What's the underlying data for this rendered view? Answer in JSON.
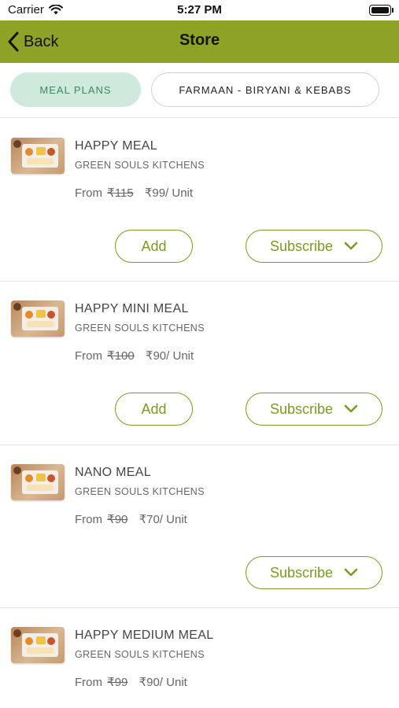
{
  "status_bar": {
    "carrier": "Carrier",
    "time": "5:27 PM"
  },
  "nav": {
    "back_label": "Back",
    "title": "Store"
  },
  "tabs": [
    {
      "label": "MEAL PLANS",
      "active": true
    },
    {
      "label": "FARMAAN - BIRYANI & KEBABS",
      "active": false
    }
  ],
  "products": [
    {
      "name": "HAPPY MEAL",
      "kitchen": "GREEN SOULS KITCHENS",
      "from_label": "From",
      "old_price": "₹115",
      "new_price": "₹99/ Unit",
      "add_label": "Add",
      "subscribe_label": "Subscribe"
    },
    {
      "name": "HAPPY MINI MEAL",
      "kitchen": "GREEN SOULS KITCHENS",
      "from_label": "From",
      "old_price": "₹100",
      "new_price": "₹90/ Unit",
      "add_label": "Add",
      "subscribe_label": "Subscribe"
    },
    {
      "name": "NANO MEAL",
      "kitchen": "GREEN SOULS KITCHENS",
      "from_label": "From",
      "old_price": "₹90",
      "new_price": "₹70/ Unit",
      "subscribe_label": "Subscribe"
    },
    {
      "name": "HAPPY MEDIUM MEAL",
      "kitchen": "GREEN SOULS KITCHENS",
      "from_label": "From",
      "old_price": "₹99",
      "new_price": "₹90/ Unit"
    }
  ],
  "colors": {
    "nav_bg": "#8ea326",
    "accent": "#7a9a22",
    "tab_active_bg": "#cfe9dc",
    "tab_active_text": "#3c8a5a"
  },
  "icons": [
    "wifi-icon",
    "battery-icon",
    "chevron-left-icon",
    "chevron-down-icon",
    "meal-thumbnail"
  ]
}
